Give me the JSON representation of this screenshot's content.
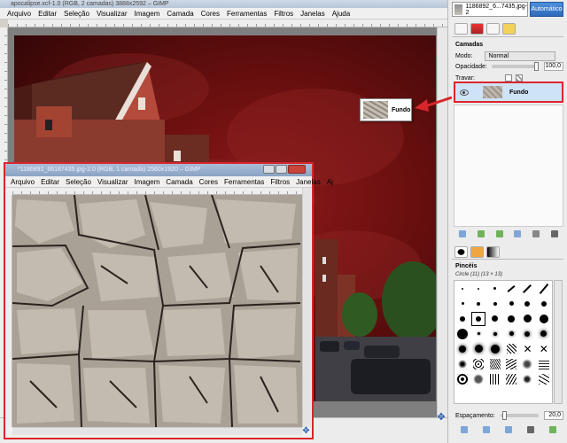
{
  "main_window": {
    "title": "apocalipse.xcf-1.0 (RGB, 2 camadas) 3888x2592 – GIMP",
    "menu": [
      "Arquivo",
      "Editar",
      "Seleção",
      "Visualizar",
      "Imagem",
      "Camada",
      "Cores",
      "Ferramentas",
      "Filtros",
      "Janelas",
      "Ajuda"
    ]
  },
  "dock": {
    "image_selector": "1186892_6...7435.jpg-2",
    "auto_button": "Automático",
    "layers_title": "Camadas",
    "mode_label": "Modo:",
    "mode_value": "Normal",
    "opacity_label": "Opacidade:",
    "opacity_value": "100,0",
    "lock_label": "Travar:",
    "layer_name": "Fundo",
    "brushes_title": "Pincéis",
    "brush_name": "Circle (11) (13 × 13)",
    "spacing_label": "Espaçamento:",
    "spacing_value": "20,0"
  },
  "callout": {
    "label": "Fundo",
    "arrow_color": "#d9262c"
  },
  "second_window": {
    "title": "*1186892_66187435.jpg-2.0 (RGB, 1 camada) 2560x1920 – GIMP",
    "menu": [
      "Arquivo",
      "Editar",
      "Seleção",
      "Visualizar",
      "Imagem",
      "Camada",
      "Cores",
      "Ferramentas",
      "Filtros",
      "Janelas",
      "Aj"
    ]
  },
  "colors": {
    "highlight": "#d9262c",
    "accent": "#2c69bb",
    "sky": "#7a1414"
  },
  "icons": [
    "eye-icon",
    "chain-icon",
    "arrow-icon",
    "navigate-icon"
  ]
}
